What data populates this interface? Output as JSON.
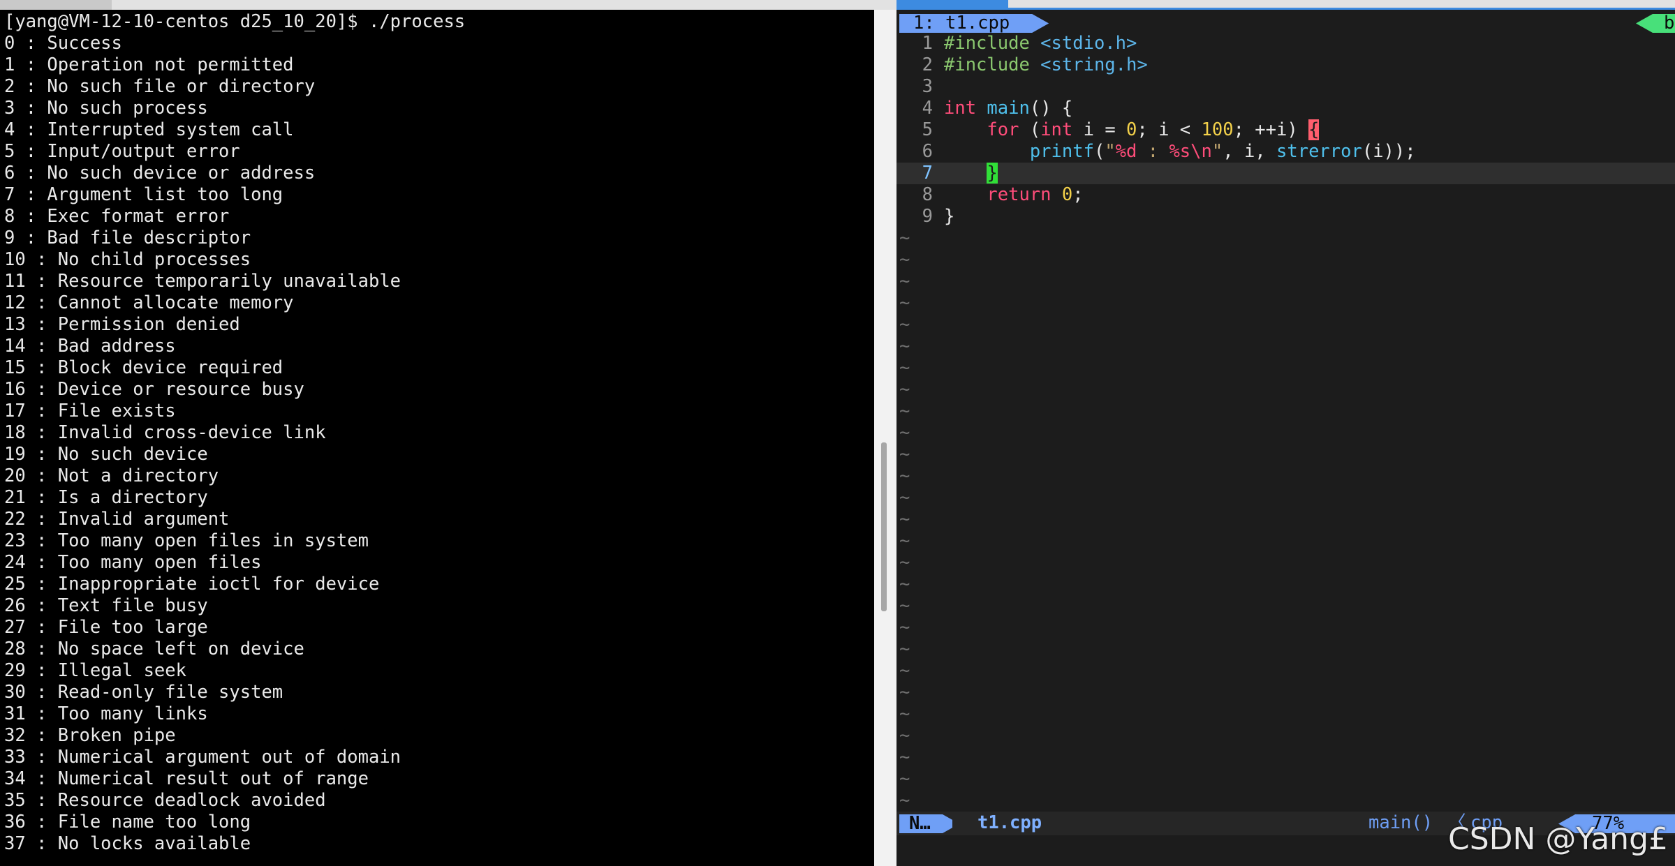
{
  "terminal": {
    "prompt": "[yang@VM-12-10-centos d25_10_20]$ ./process",
    "lines": [
      "0 : Success",
      "1 : Operation not permitted",
      "2 : No such file or directory",
      "3 : No such process",
      "4 : Interrupted system call",
      "5 : Input/output error",
      "6 : No such device or address",
      "7 : Argument list too long",
      "8 : Exec format error",
      "9 : Bad file descriptor",
      "10 : No child processes",
      "11 : Resource temporarily unavailable",
      "12 : Cannot allocate memory",
      "13 : Permission denied",
      "14 : Bad address",
      "15 : Block device required",
      "16 : Device or resource busy",
      "17 : File exists",
      "18 : Invalid cross-device link",
      "19 : No such device",
      "20 : Not a directory",
      "21 : Is a directory",
      "22 : Invalid argument",
      "23 : Too many open files in system",
      "24 : Too many open files",
      "25 : Inappropriate ioctl for device",
      "26 : Text file busy",
      "27 : File too large",
      "28 : No space left on device",
      "29 : Illegal seek",
      "30 : Read-only file system",
      "31 : Too many links",
      "32 : Broken pipe",
      "33 : Numerical argument out of domain",
      "34 : Numerical result out of range",
      "35 : Resource deadlock avoided",
      "36 : File name too long",
      "37 : No locks available"
    ]
  },
  "vim": {
    "tab_label": "1: t1.cpp",
    "buffer_flag": "bu",
    "code": {
      "l1": {
        "pp": "#include",
        "inc": " <stdio.h>"
      },
      "l2": {
        "pp": "#include",
        "inc": " <string.h>"
      },
      "l4": {
        "kw_int": "int",
        "fn_main": "main",
        "rest": "() {"
      },
      "l5": {
        "indent": "    ",
        "kw_for": "for",
        "p1": " (",
        "kw_int": "int",
        "p2": " i = ",
        "n0": "0",
        "p3": "; i < ",
        "n100": "100",
        "p4": "; ++i) ",
        "brace": "{"
      },
      "l6": {
        "indent": "        ",
        "fn_printf": "printf",
        "p1": "(",
        "q1": "\"",
        "fmt1": "%d",
        "mid": " : ",
        "fmt2": "%s",
        "esc": "\\n",
        "q2": "\"",
        "p2": ", i, ",
        "fn_strerror": "strerror",
        "p3": "(i));"
      },
      "l7": {
        "indent": "    ",
        "brace": "}"
      },
      "l8": {
        "indent": "    ",
        "kw_return": "return",
        "sp": " ",
        "n0": "0",
        "semi": ";"
      },
      "l9": {
        "text": "}"
      }
    },
    "tilde": "~",
    "tilde_count": 27,
    "status": {
      "mode": "N…",
      "filename": "t1.cpp",
      "function": "main()",
      "separator": "〈",
      "filetype": "cpp",
      "percent": "77%"
    },
    "colors": {
      "keyword": "#ff4d7a",
      "function": "#4fc0ec",
      "number": "#f3d14a",
      "accent_blue": "#6f9ff6",
      "accent_green": "#48e07a"
    }
  },
  "watermark": "CSDN @Yang£"
}
